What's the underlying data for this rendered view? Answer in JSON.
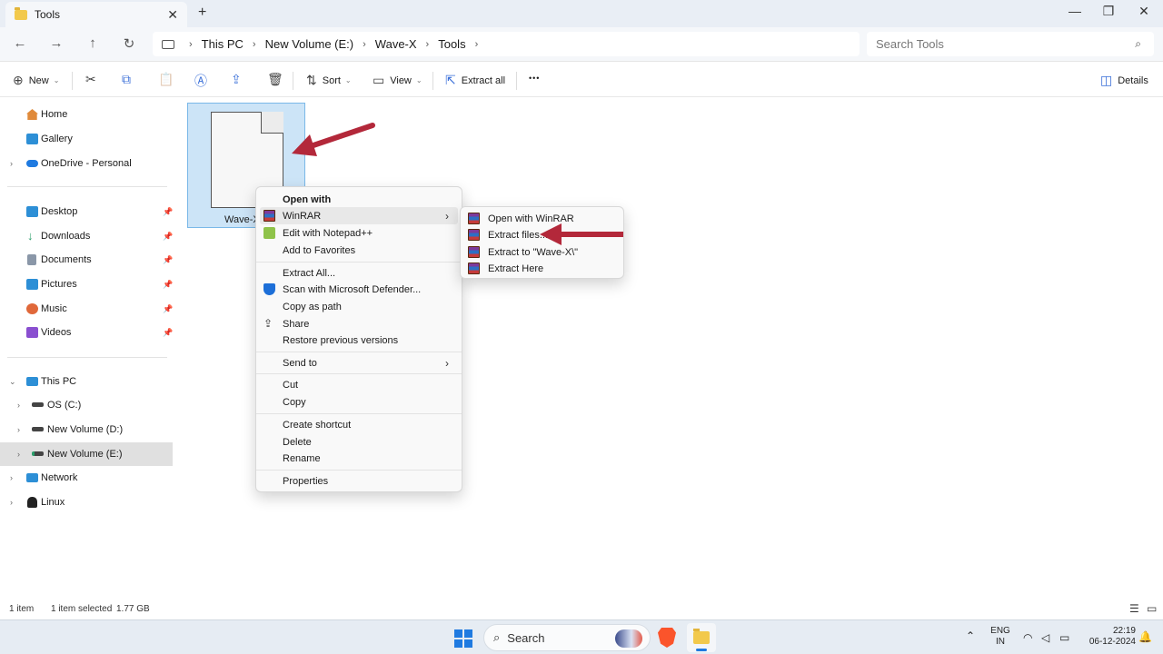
{
  "window": {
    "tab_title": "Tools",
    "tab_close": "✕",
    "new_tab": "+",
    "minimize": "—",
    "maximize": "❐",
    "close": "✕"
  },
  "nav": {
    "back": "←",
    "forward": "→",
    "up": "↑",
    "refresh": "↻"
  },
  "address": {
    "crumbs": [
      "This PC",
      "New Volume (E:)",
      "Wave-X",
      "Tools"
    ],
    "sep": "›"
  },
  "search": {
    "placeholder": "Search Tools",
    "icon": "⌕"
  },
  "toolbar": {
    "new_label": "New",
    "sort_label": "Sort",
    "view_label": "View",
    "extract_all_label": "Extract all",
    "more_label": "•••",
    "details_label": "Details",
    "caret": "⌄",
    "icons": {
      "new": "⊕",
      "cut": "✂",
      "copy": "⧉",
      "paste": "📋",
      "rename": "Ⓐ",
      "share": "⇪",
      "delete": "🗑",
      "sort": "⇅",
      "view": "▭",
      "extract": "⇱",
      "details": "◫"
    }
  },
  "sidebar": {
    "items": [
      {
        "label": "Home",
        "icon": "home-icon",
        "color": "#e08a3a"
      },
      {
        "label": "Gallery",
        "icon": "gallery-icon",
        "color": "#2d8fd6"
      },
      {
        "label": "OneDrive - Personal",
        "icon": "cloud-icon",
        "color": "#1f7ae0"
      },
      {
        "label": "Desktop",
        "icon": "desktop-icon",
        "color": "#2d8fd6"
      },
      {
        "label": "Downloads",
        "icon": "download-icon",
        "color": "#2a9d6a"
      },
      {
        "label": "Documents",
        "icon": "documents-icon",
        "color": "#8a97a8"
      },
      {
        "label": "Pictures",
        "icon": "pictures-icon",
        "color": "#2d8fd6"
      },
      {
        "label": "Music",
        "icon": "music-icon",
        "color": "#e0683a"
      },
      {
        "label": "Videos",
        "icon": "videos-icon",
        "color": "#8a4fd0"
      },
      {
        "label": "This PC",
        "icon": "computer-icon",
        "color": "#2d8fd6"
      },
      {
        "label": "OS (C:)",
        "icon": "drive-icon",
        "color": "#444444"
      },
      {
        "label": "New Volume (D:)",
        "icon": "drive-icon",
        "color": "#444444"
      },
      {
        "label": "New Volume (E:)",
        "icon": "drive-icon",
        "color": "#2a9d6a"
      },
      {
        "label": "Network",
        "icon": "network-icon",
        "color": "#2d8fd6"
      },
      {
        "label": "Linux",
        "icon": "linux-icon",
        "color": "#222222"
      }
    ],
    "pin": "📌",
    "chevron_right": "›",
    "chevron_down": "⌄"
  },
  "file": {
    "name": "Wave-X"
  },
  "context_menu": {
    "header": "Open with",
    "items": [
      {
        "label": "WinRAR",
        "icon": "winrar-icon",
        "submenu": true
      },
      {
        "label": "Edit with Notepad++",
        "icon": "notepadpp-icon"
      },
      {
        "label": "Add to Favorites",
        "icon": ""
      },
      {
        "label": "Extract All...",
        "icon": ""
      },
      {
        "label": "Scan with Microsoft Defender...",
        "icon": "defender-icon"
      },
      {
        "label": "Copy as path",
        "icon": ""
      },
      {
        "label": "Share",
        "icon": "share-icon"
      },
      {
        "label": "Restore previous versions",
        "icon": ""
      },
      {
        "label": "Send to",
        "icon": "",
        "submenu": true
      },
      {
        "label": "Cut",
        "icon": ""
      },
      {
        "label": "Copy",
        "icon": ""
      },
      {
        "label": "Create shortcut",
        "icon": ""
      },
      {
        "label": "Delete",
        "icon": ""
      },
      {
        "label": "Rename",
        "icon": ""
      },
      {
        "label": "Properties",
        "icon": ""
      }
    ],
    "submenu_arrow": "›"
  },
  "winrar_submenu": {
    "items": [
      {
        "label": "Open with WinRAR"
      },
      {
        "label": "Extract files..."
      },
      {
        "label": "Extract to \"Wave-X\\\""
      },
      {
        "label": "Extract Here"
      }
    ]
  },
  "status": {
    "count": "1 item",
    "selected": "1 item selected",
    "size": "1.77 GB"
  },
  "taskbar": {
    "search_label": "Search",
    "lang_top": "ENG",
    "lang_bottom": "IN",
    "time": "22:19",
    "date": "06-12-2024"
  },
  "colors": {
    "accent": "#1f7ae0",
    "annotation": "#b3283a",
    "selection_fill": "#cce4f7"
  }
}
